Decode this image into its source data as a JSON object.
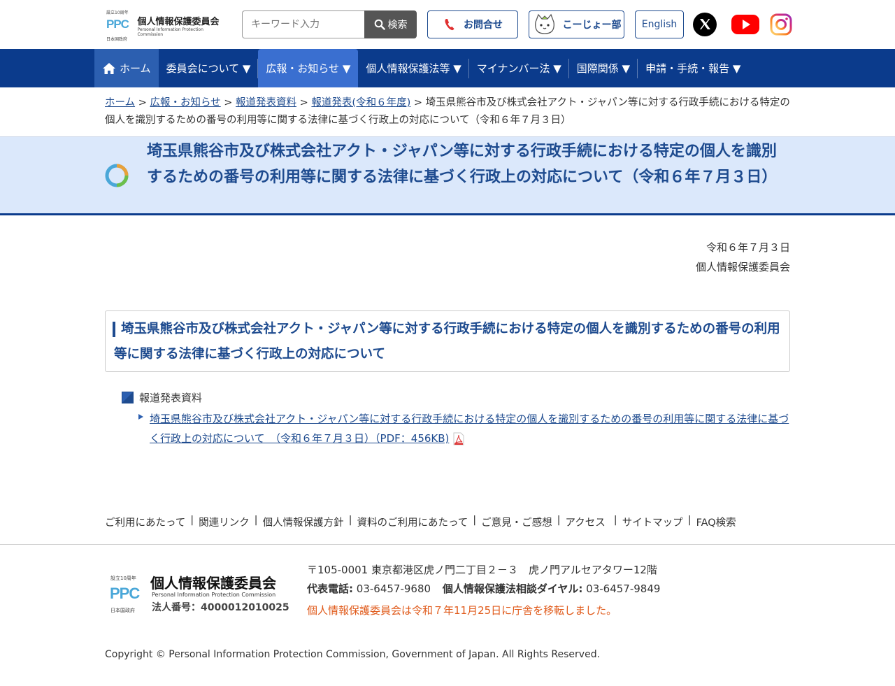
{
  "header": {
    "logo": {
      "ppc_text": "PPC",
      "top_text": "設立10周年",
      "bottom_text": "日本国政府",
      "jp_name": "個人情報保護委員会",
      "en_name": "Personal Information Protection Commission"
    },
    "search": {
      "placeholder": "キーワード入力",
      "button_label": "検索"
    },
    "contact_label": "お問合せ",
    "koujo_label": "こーじょー部",
    "english_label": "English"
  },
  "nav": {
    "items": [
      {
        "label": "ホーム"
      },
      {
        "label": "委員会について ▼"
      },
      {
        "label": "広報・お知らせ ▼"
      },
      {
        "label": "個人情報保護法等 ▼"
      },
      {
        "label": "マイナンバー法 ▼"
      },
      {
        "label": "国際関係 ▼"
      },
      {
        "label": "申請・手続・報告 ▼"
      }
    ]
  },
  "breadcrumb": {
    "items": [
      "ホーム",
      "広報・お知らせ",
      "報道発表資料",
      "報道発表(令和６年度)"
    ],
    "separator": ">",
    "current": "埼玉県熊谷市及び株式会社アクト・ジャパン等に対する行政手続における特定の個人を識別するための番号の利用等に関する法律に基づく行政上の対応について（令和６年７月３日）"
  },
  "page_title": "埼玉県熊谷市及び株式会社アクト・ジャパン等に対する行政手続における特定の個人を識別するための番号の利用等に関する法律に基づく行政上の対応について（令和６年７月３日）",
  "date": "令和６年７月３日",
  "author": "個人情報保護委員会",
  "section_heading": "埼玉県熊谷市及び株式会社アクト・ジャパン等に対する行政手続における特定の個人を識別するための番号の利用等に関する法律に基づく行政上の対応について",
  "doc_label": "報道発表資料",
  "doc_link": "埼玉県熊谷市及び株式会社アクト・ジャパン等に対する行政手続における特定の個人を識別するための番号の利用等に関する法律に基づく行政上の対応について　（令和６年７月３日）（PDF：456KB)",
  "footer_links": [
    "ご利用にあたって",
    "関連リンク",
    "個人情報保護方針",
    "資料のご利用にあたって",
    "ご意見・ご感想",
    "アクセス",
    "サイトマップ",
    "FAQ検索"
  ],
  "footer": {
    "logo_name": "個人情報保護委員会",
    "logo_en": "Personal Information Protection Commission",
    "corp_number": "法人番号：4000012010025",
    "address": "〒105-0001 東京都港区虎ノ門二丁目２－３　虎ノ門アルセアタワー12階",
    "tel_label": "代表電話:",
    "tel": "03-6457-9680",
    "dial_label": "個人情報保護法相談ダイヤル:",
    "dial": "03-6457-9849",
    "notice": "個人情報保護委員会は令和７年11月25日に庁舎を移転しました。",
    "copyright": "Copyright © Personal Information Protection Commission, Government of Japan. All Rights Reserved."
  },
  "colors": {
    "brand_navy": "#0b3b8c",
    "link_blue": "#1e4b8f",
    "title_band": "#dbe8fb",
    "notice_orange": "#e05a1a"
  }
}
